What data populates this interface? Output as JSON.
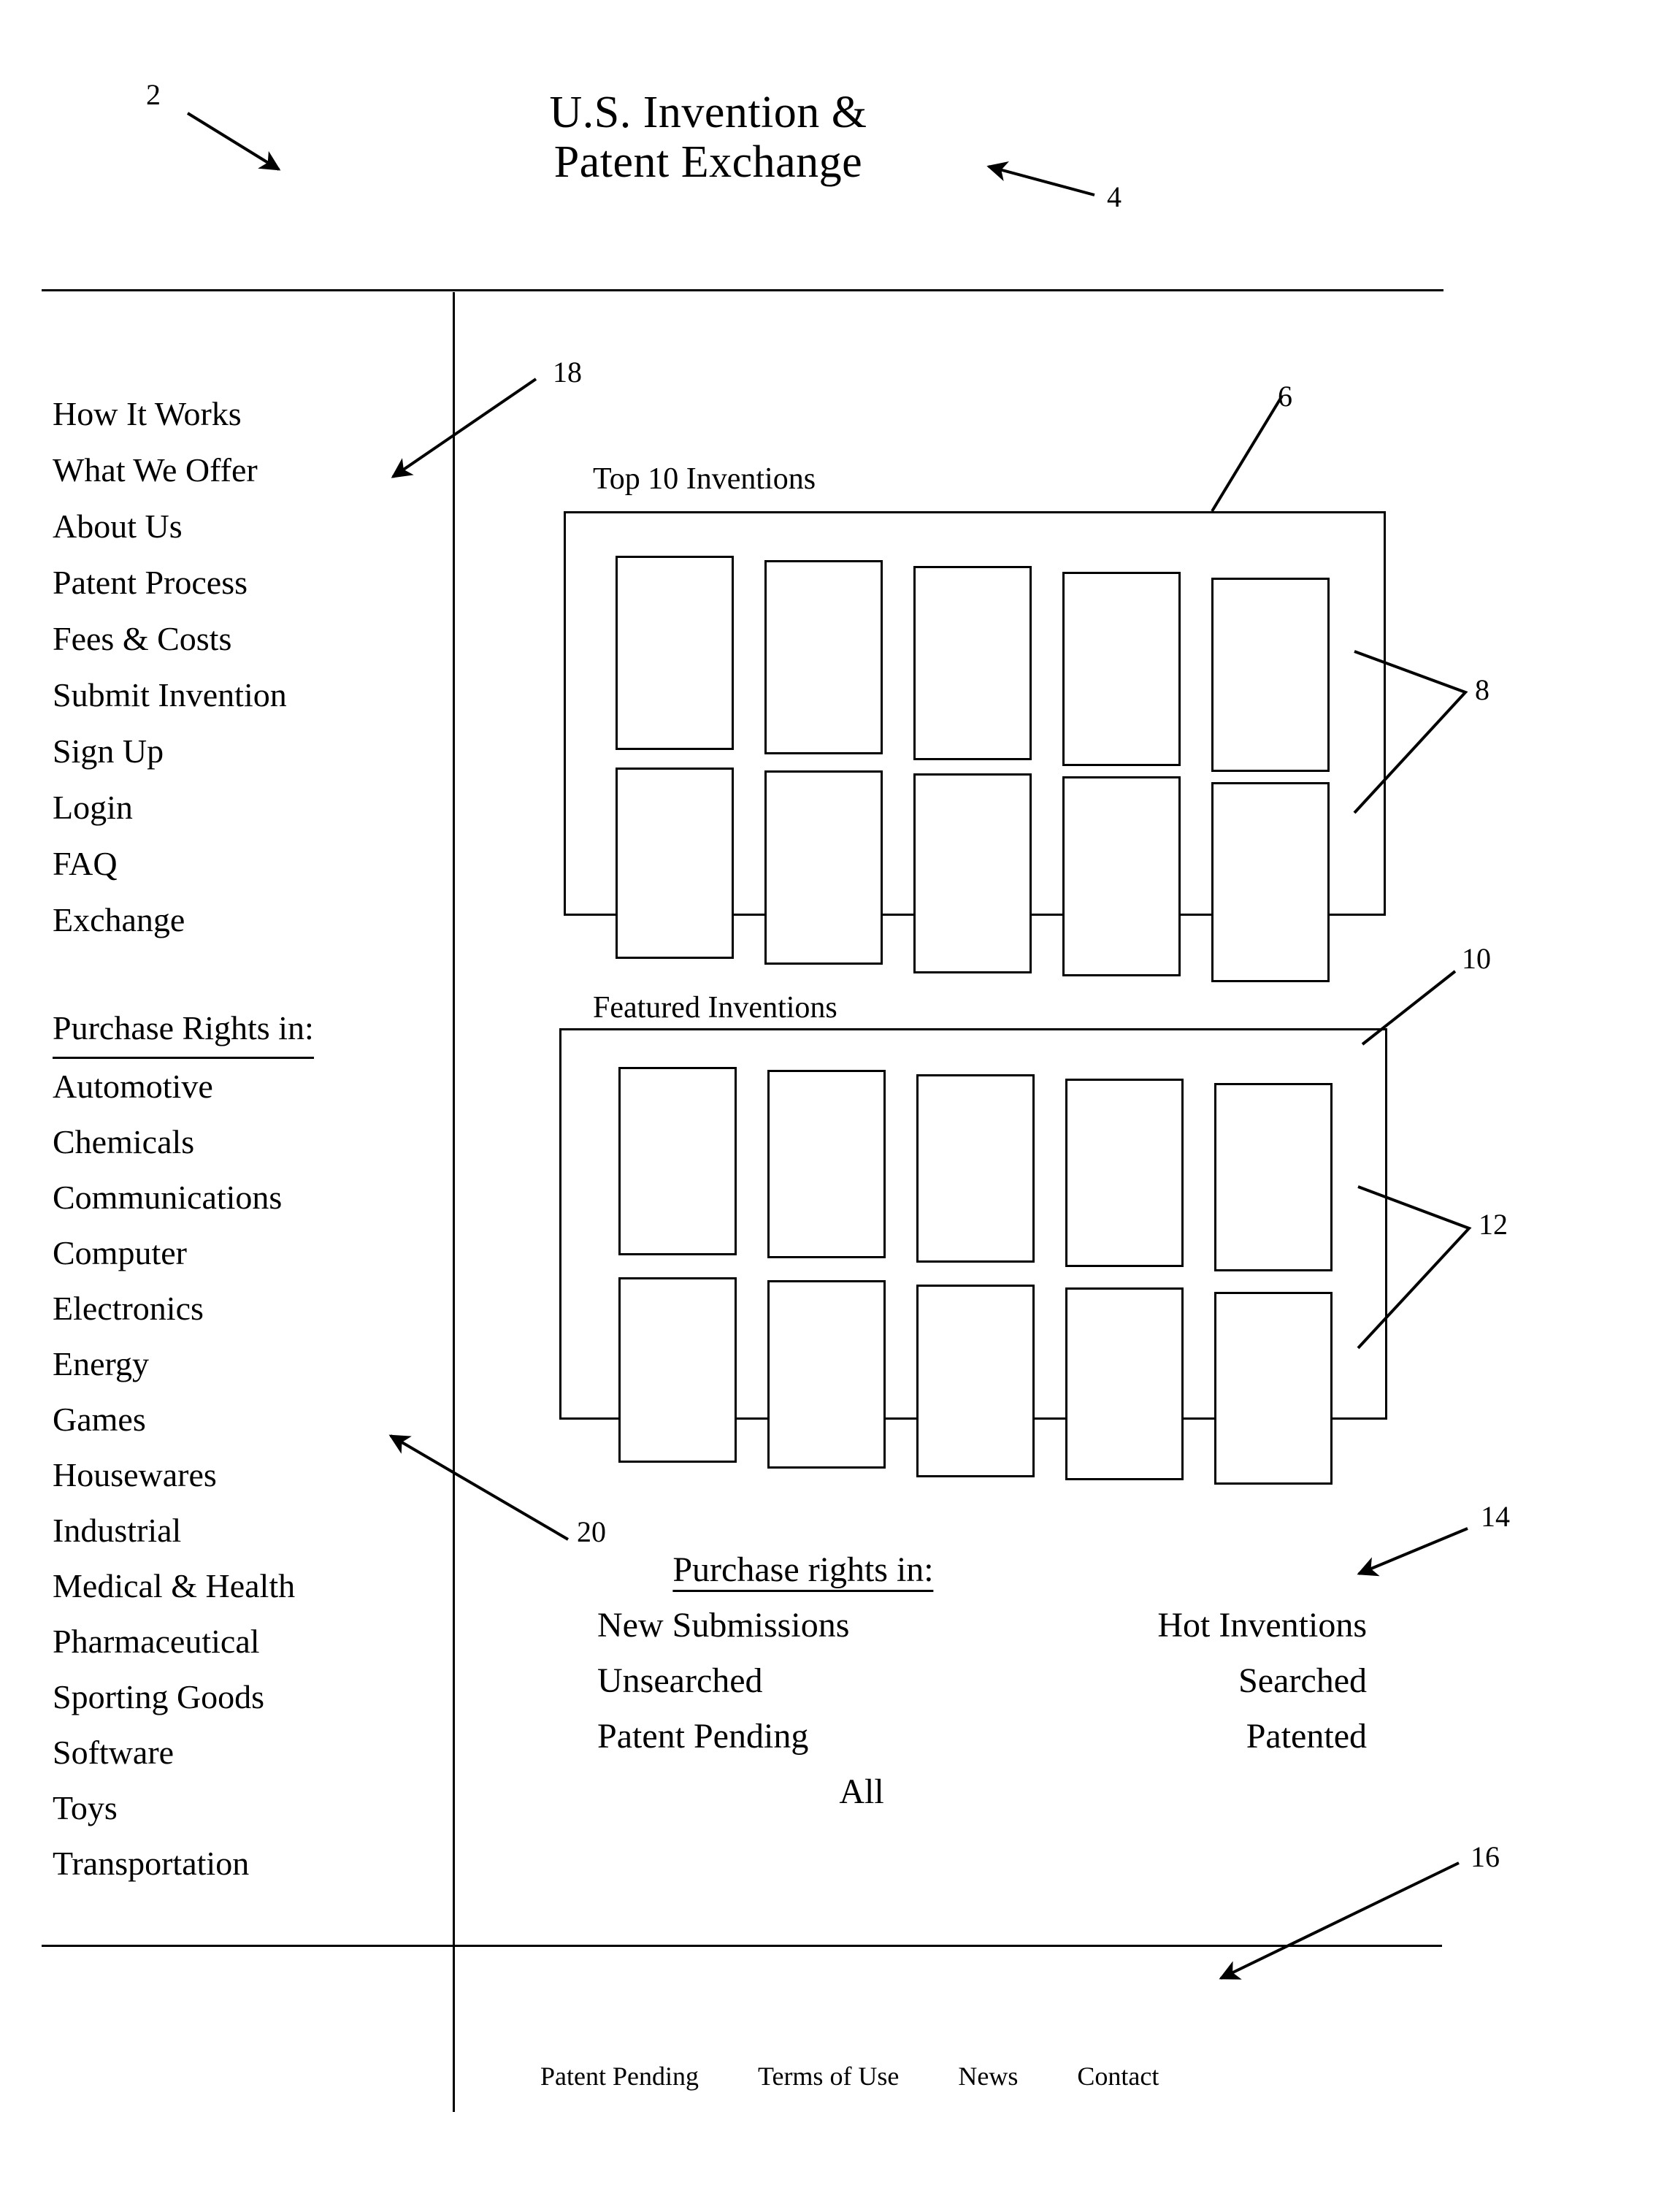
{
  "figure": {
    "title": "U.S. Invention &\nPatent Exchange"
  },
  "sidebar": {
    "nav_items": [
      {
        "label": "How It Works"
      },
      {
        "label": "What We Offer"
      },
      {
        "label": "About Us"
      },
      {
        "label": "Patent Process"
      },
      {
        "label": "Fees & Costs"
      },
      {
        "label": "Submit Invention"
      },
      {
        "label": "Sign Up"
      },
      {
        "label": "Login"
      },
      {
        "label": "FAQ"
      },
      {
        "label": "Exchange"
      }
    ],
    "categories_heading": "Purchase Rights in:",
    "categories": [
      {
        "label": "Automotive"
      },
      {
        "label": "Chemicals"
      },
      {
        "label": "Communications"
      },
      {
        "label": "Computer"
      },
      {
        "label": "Electronics"
      },
      {
        "label": "Energy"
      },
      {
        "label": "Games"
      },
      {
        "label": "Housewares"
      },
      {
        "label": "Industrial"
      },
      {
        "label": "Medical & Health"
      },
      {
        "label": "Pharmaceutical"
      },
      {
        "label": "Sporting Goods"
      },
      {
        "label": "Software"
      },
      {
        "label": "Toys"
      },
      {
        "label": "Transportation"
      }
    ]
  },
  "main": {
    "top_panel": {
      "label": "Top 10 Inventions",
      "tile_count": 10
    },
    "featured_panel": {
      "label": "Featured Inventions",
      "tile_count": 10
    },
    "purchase_rights": {
      "heading": "Purchase rights in:",
      "left_column": [
        {
          "label": "New Submissions"
        },
        {
          "label": "Unsearched"
        },
        {
          "label": "Patent Pending"
        }
      ],
      "right_column": [
        {
          "label": "Hot Inventions"
        },
        {
          "label": "Searched"
        },
        {
          "label": "Patented"
        }
      ],
      "all_option": "All"
    }
  },
  "footer": {
    "links": [
      {
        "label": "Patent Pending"
      },
      {
        "label": "Terms of Use"
      },
      {
        "label": "News"
      },
      {
        "label": "Contact"
      }
    ]
  },
  "reference_numerals": [
    {
      "id": "ref-2",
      "label": "2"
    },
    {
      "id": "ref-4",
      "label": "4"
    },
    {
      "id": "ref-6",
      "label": "6"
    },
    {
      "id": "ref-8",
      "label": "8"
    },
    {
      "id": "ref-10",
      "label": "10"
    },
    {
      "id": "ref-12",
      "label": "12"
    },
    {
      "id": "ref-14",
      "label": "14"
    },
    {
      "id": "ref-16",
      "label": "16"
    },
    {
      "id": "ref-18",
      "label": "18"
    },
    {
      "id": "ref-20",
      "label": "20"
    }
  ]
}
